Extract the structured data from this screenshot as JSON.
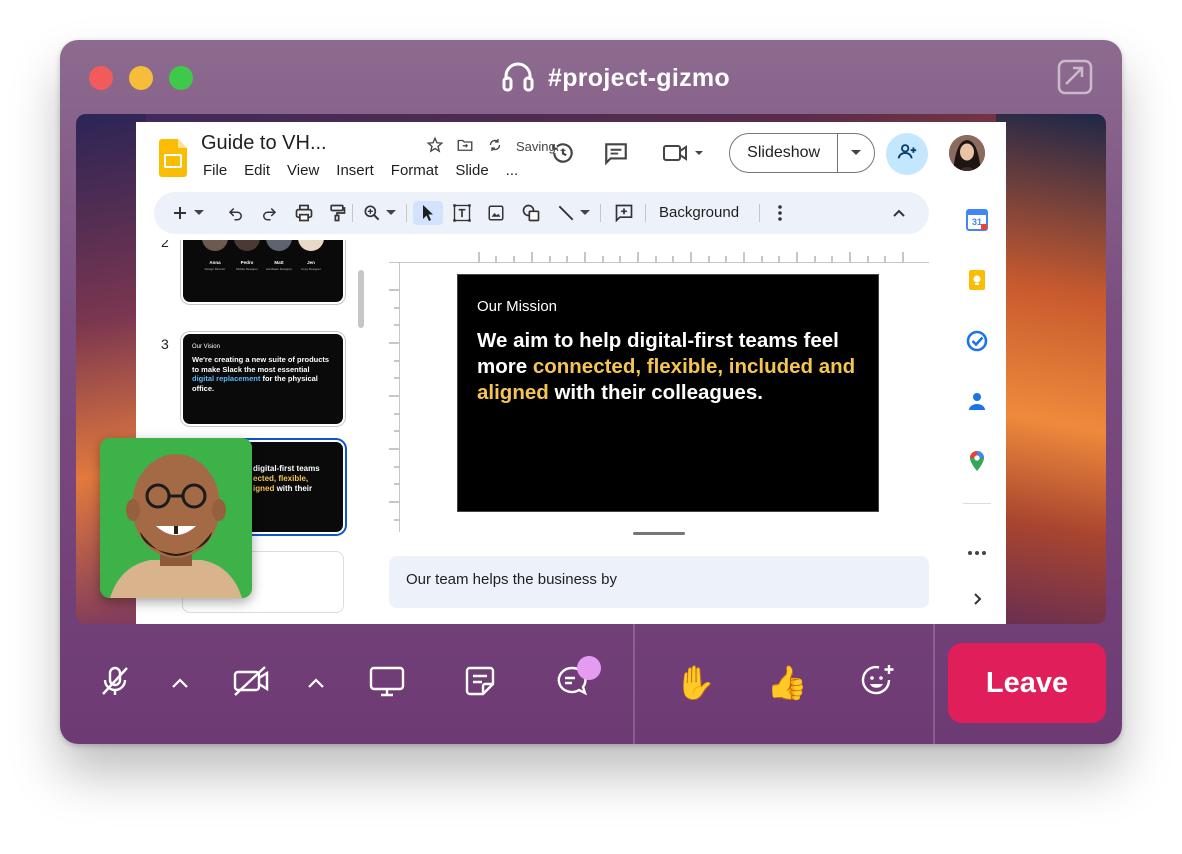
{
  "window": {
    "title": "#project-gizmo"
  },
  "slides_app": {
    "doc_title": "Guide to VH...",
    "menus": [
      "File",
      "Edit",
      "View",
      "Insert",
      "Format",
      "Slide",
      "..."
    ],
    "saving_label": "Saving...",
    "slideshow_label": "Slideshow",
    "toolbar": {
      "background_label": "Background"
    },
    "filmstrip": {
      "slide2_number": "2",
      "slide2_people": [
        {
          "name": "Anna",
          "role": "Design Director"
        },
        {
          "name": "Pedro",
          "role": "Mobile Designer"
        },
        {
          "name": "Matt",
          "role": "Hardware Designer"
        },
        {
          "name": "Jen",
          "role": "Copy Designer"
        }
      ],
      "slide3_number": "3",
      "slide3_caption": "Our Vision",
      "slide3_text_a": "We're creating a new suite of products to make Slack the most essential ",
      "slide3_text_hl": "digital replacement",
      "slide3_text_b": " for the physical office.",
      "slide4_line1": "digital-first teams",
      "slide4_line2_hl": "ected, flexible,",
      "slide4_line3_hl": "igned",
      "slide4_line3_rest": " with their"
    },
    "main_slide": {
      "caption": "Our Mission",
      "text_a": "We aim to help digital-first teams feel more ",
      "text_hl1": "connected, flexible, included and aligned",
      "text_b": " with their colleagues."
    },
    "notes": "Our team helps the business by",
    "side_apps": [
      "calendar-icon",
      "keep-icon",
      "tasks-icon",
      "contacts-icon",
      "maps-icon"
    ]
  },
  "controls": {
    "leave_label": "Leave",
    "hand_emoji": "✋",
    "thumbs_emoji": "👍"
  },
  "colors": {
    "leave": "#e01e5a",
    "highlight": "#f5c451",
    "accent_blue": "#0b57d0"
  }
}
